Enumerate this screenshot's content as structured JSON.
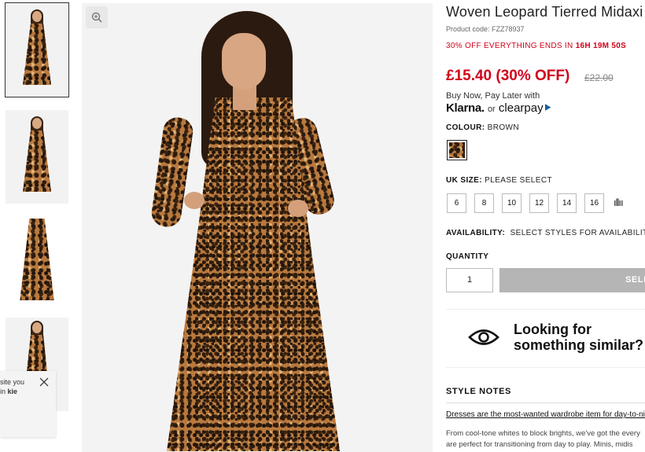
{
  "product": {
    "title": "Woven Leopard Tierred Midaxi",
    "code_label": "Product code: FZZ78937",
    "promo": "30% OFF EVERYTHING ENDS IN",
    "promo_timer": "16H 19M 50S",
    "price": "£15.40 (30% OFF)",
    "was_price": "£22.00",
    "bnpl": "Buy Now, Pay Later with",
    "klarna": "Klarna.",
    "or": "or",
    "clearpay": "clearpay",
    "colour_label": "COLOUR:",
    "colour_value": "BROWN",
    "size_label": "UK SIZE:",
    "size_value": "PLEASE SELECT",
    "sizes": [
      "6",
      "8",
      "10",
      "12",
      "14",
      "16"
    ],
    "availability_label": "AVAILABILITY:",
    "availability_value": "SELECT STYLES FOR AVAILABILITY",
    "quantity_label": "QUANTITY",
    "quantity_value": "1",
    "add_button": "SELECT SIZE"
  },
  "similar": {
    "text": "Looking for\nsomething similar?"
  },
  "notes": {
    "heading": "STYLE NOTES",
    "link": "Dresses are the most-wanted wardrobe item for day-to-night",
    "body": "From cool-tone whites to block brights, we've got the every\nare perfect for transitioning from day to play. Minis, midis"
  },
  "cookie": {
    "text": "site you\nin ",
    "link": "kie"
  },
  "colors": {
    "sale": "#d0021b",
    "button": "#b5b5b5",
    "clearpay_mark": "#1a5f9e"
  },
  "icons": [
    "zoom-icon",
    "close-icon",
    "eye-icon",
    "size-guide-icon"
  ]
}
